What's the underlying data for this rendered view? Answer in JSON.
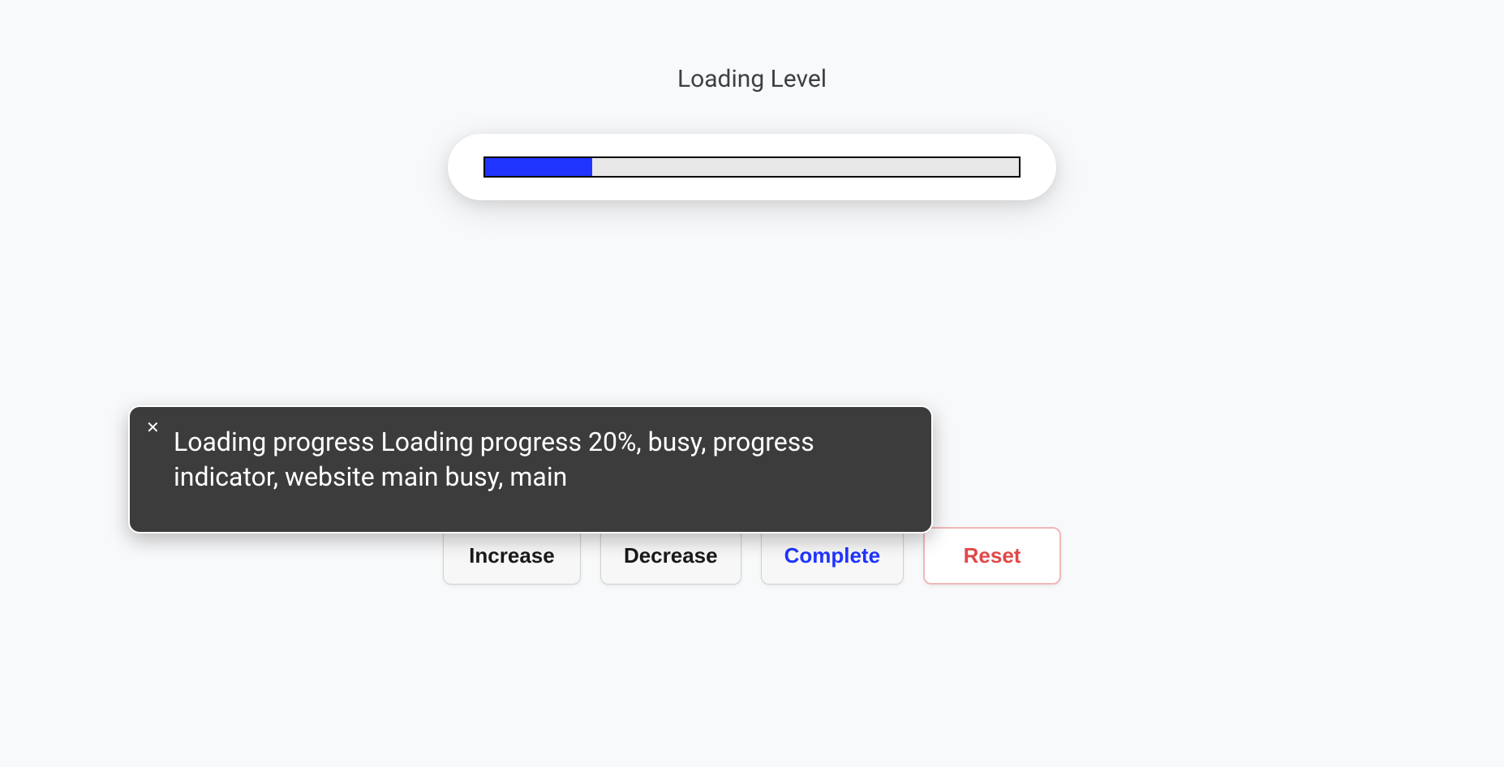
{
  "title": "Loading Level",
  "progress": {
    "percent": 20
  },
  "buttons": {
    "increase": "Increase",
    "decrease": "Decrease",
    "complete": "Complete",
    "reset": "Reset"
  },
  "tooltip": {
    "text": "Loading progress Loading progress 20%, busy, progress indicator, website main busy, main",
    "close_glyph": "✕"
  }
}
